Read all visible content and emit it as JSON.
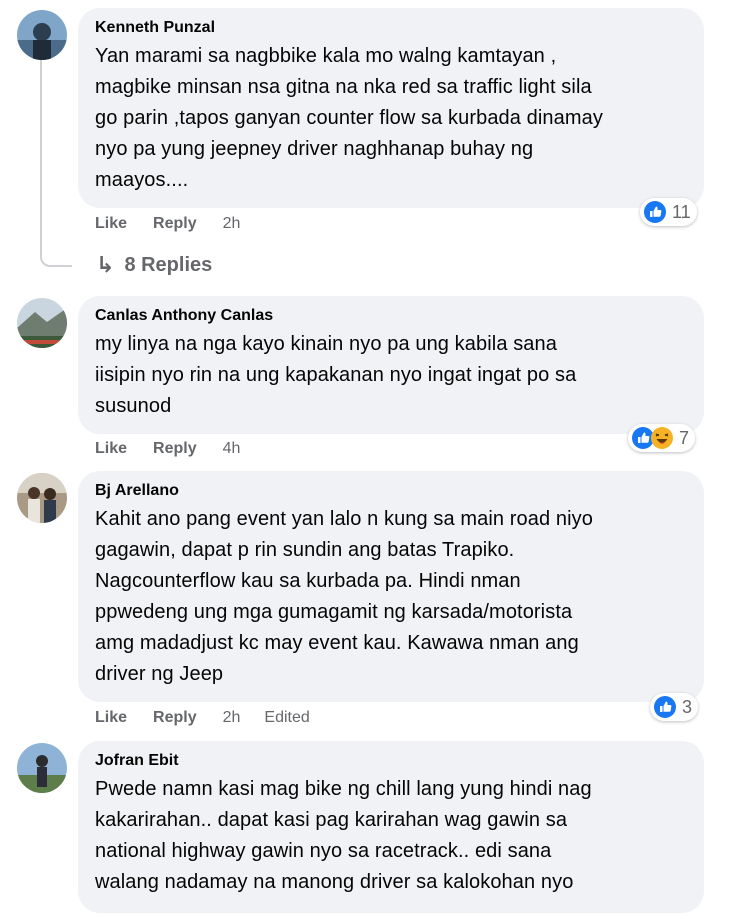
{
  "comments": [
    {
      "author": "Kenneth Punzal",
      "text": "Yan marami sa nagbbike kala mo walng kamtayan ,\nmagbike minsan nsa gitna na nka red sa traffic light sila\ngo parin ,tapos ganyan counter flow sa kurbada dinamay\nnyo pa yung jeepney driver naghhanap buhay ng\nmaayos....",
      "like_label": "Like",
      "reply_label": "Reply",
      "time": "2h",
      "reaction_count": "11",
      "replies_label": "8 Replies"
    },
    {
      "author": "Canlas Anthony Canlas",
      "text": "my linya na nga kayo kinain nyo pa ung kabila sana\niisipin nyo rin na ung kapakanan nyo ingat ingat po sa\nsusunod",
      "like_label": "Like",
      "reply_label": "Reply",
      "time": "4h",
      "reaction_count": "7"
    },
    {
      "author": "Bj Arellano",
      "text": "Kahit ano pang event yan lalo n kung sa main road niyo\ngagawin, dapat p rin sundin ang batas Trapiko.\nNagcounterflow kau sa kurbada pa. Hindi nman\nppwedeng ung mga gumagamit ng karsada/motorista\namg madadjust kc may event kau. Kawawa nman ang\ndriver ng Jeep",
      "like_label": "Like",
      "reply_label": "Reply",
      "time": "2h",
      "edited": "Edited",
      "reaction_count": "3"
    },
    {
      "author": "Jofran Ebit",
      "text": "Pwede namn kasi mag bike ng chill lang yung hindi nag\nkakarirahan.. dapat kasi pag karirahan wag gawin sa\nnational highway gawin nyo sa racetrack.. edi sana\nwalang nadamay na manong driver sa kalokohan nyo"
    }
  ],
  "icons": {
    "like": "like-icon",
    "haha": "haha-icon",
    "reply_arrow": "reply-arrow-icon"
  },
  "colors": {
    "bubble": "#f0f2f5",
    "meta": "#65676b",
    "like_blue": "#1877f2",
    "haha_yellow": "#f7b125"
  }
}
